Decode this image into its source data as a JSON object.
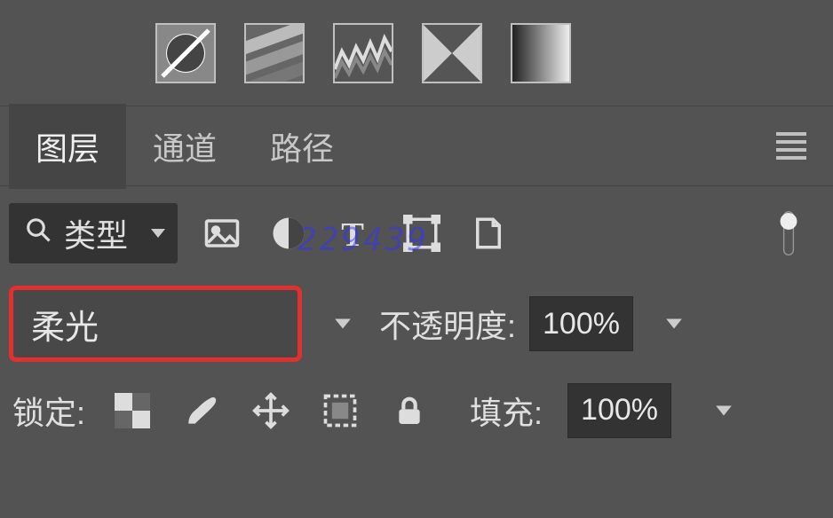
{
  "tabs": {
    "layers": "图层",
    "channels": "通道",
    "paths": "路径"
  },
  "filter": {
    "type_label": "类型"
  },
  "blend": {
    "mode": "柔光",
    "opacity_label": "不透明度:",
    "opacity_value": "100%"
  },
  "lock": {
    "label": "锁定:",
    "fill_label": "填充:",
    "fill_value": "100%"
  },
  "watermark": "229439"
}
